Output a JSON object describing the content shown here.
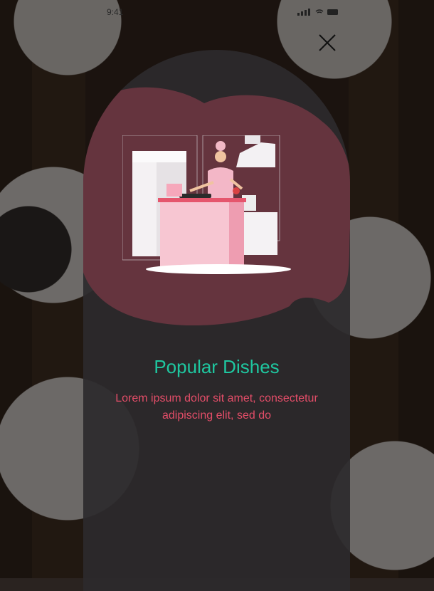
{
  "status_bar": {
    "time": "9:41"
  },
  "onboarding": {
    "title": "Popular Dishes",
    "description": "Lorem ipsum dolor sit amet, consectetur adipiscing elit, sed do"
  },
  "icons": {
    "close": "close-icon",
    "illustration": "chef-cooking-illustration"
  },
  "colors": {
    "title": "#1fc7a0",
    "description": "#e34d68",
    "blob": "#6b3540",
    "card": "#2d2a2c"
  }
}
